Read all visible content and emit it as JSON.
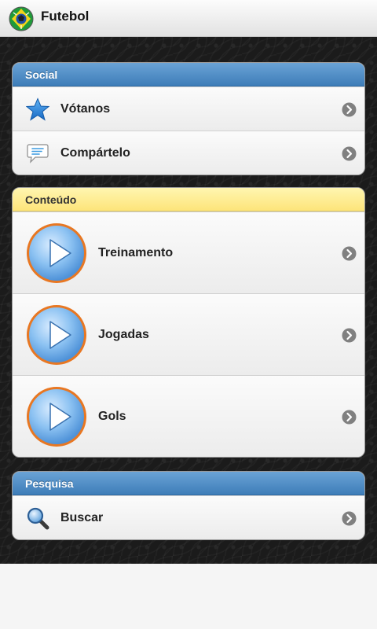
{
  "app": {
    "title": "Futebol",
    "icon": "soccer-ball-icon"
  },
  "groups": [
    {
      "header": "Social",
      "header_color": "#4a8ac6",
      "items": [
        {
          "label": "Vótanos",
          "icon": "star-icon"
        },
        {
          "label": "Compártelo",
          "icon": "chat-bubble-icon"
        }
      ]
    },
    {
      "header": "Conteúdo",
      "header_color": "#fde98a",
      "items": [
        {
          "label": "Treinamento",
          "icon": "play-button-icon"
        },
        {
          "label": "Jogadas",
          "icon": "play-button-icon"
        },
        {
          "label": "Gols",
          "icon": "play-button-icon"
        }
      ]
    },
    {
      "header": "Pesquisa",
      "header_color": "#4a8ac6",
      "items": [
        {
          "label": "Buscar",
          "icon": "magnifier-icon"
        }
      ]
    }
  ],
  "colors": {
    "accent_blue": "#3e7db8",
    "accent_yellow": "#fde47a",
    "play_ring": "#e87722",
    "play_fill": "#7fb6ea",
    "background": "#1b1b1b"
  }
}
